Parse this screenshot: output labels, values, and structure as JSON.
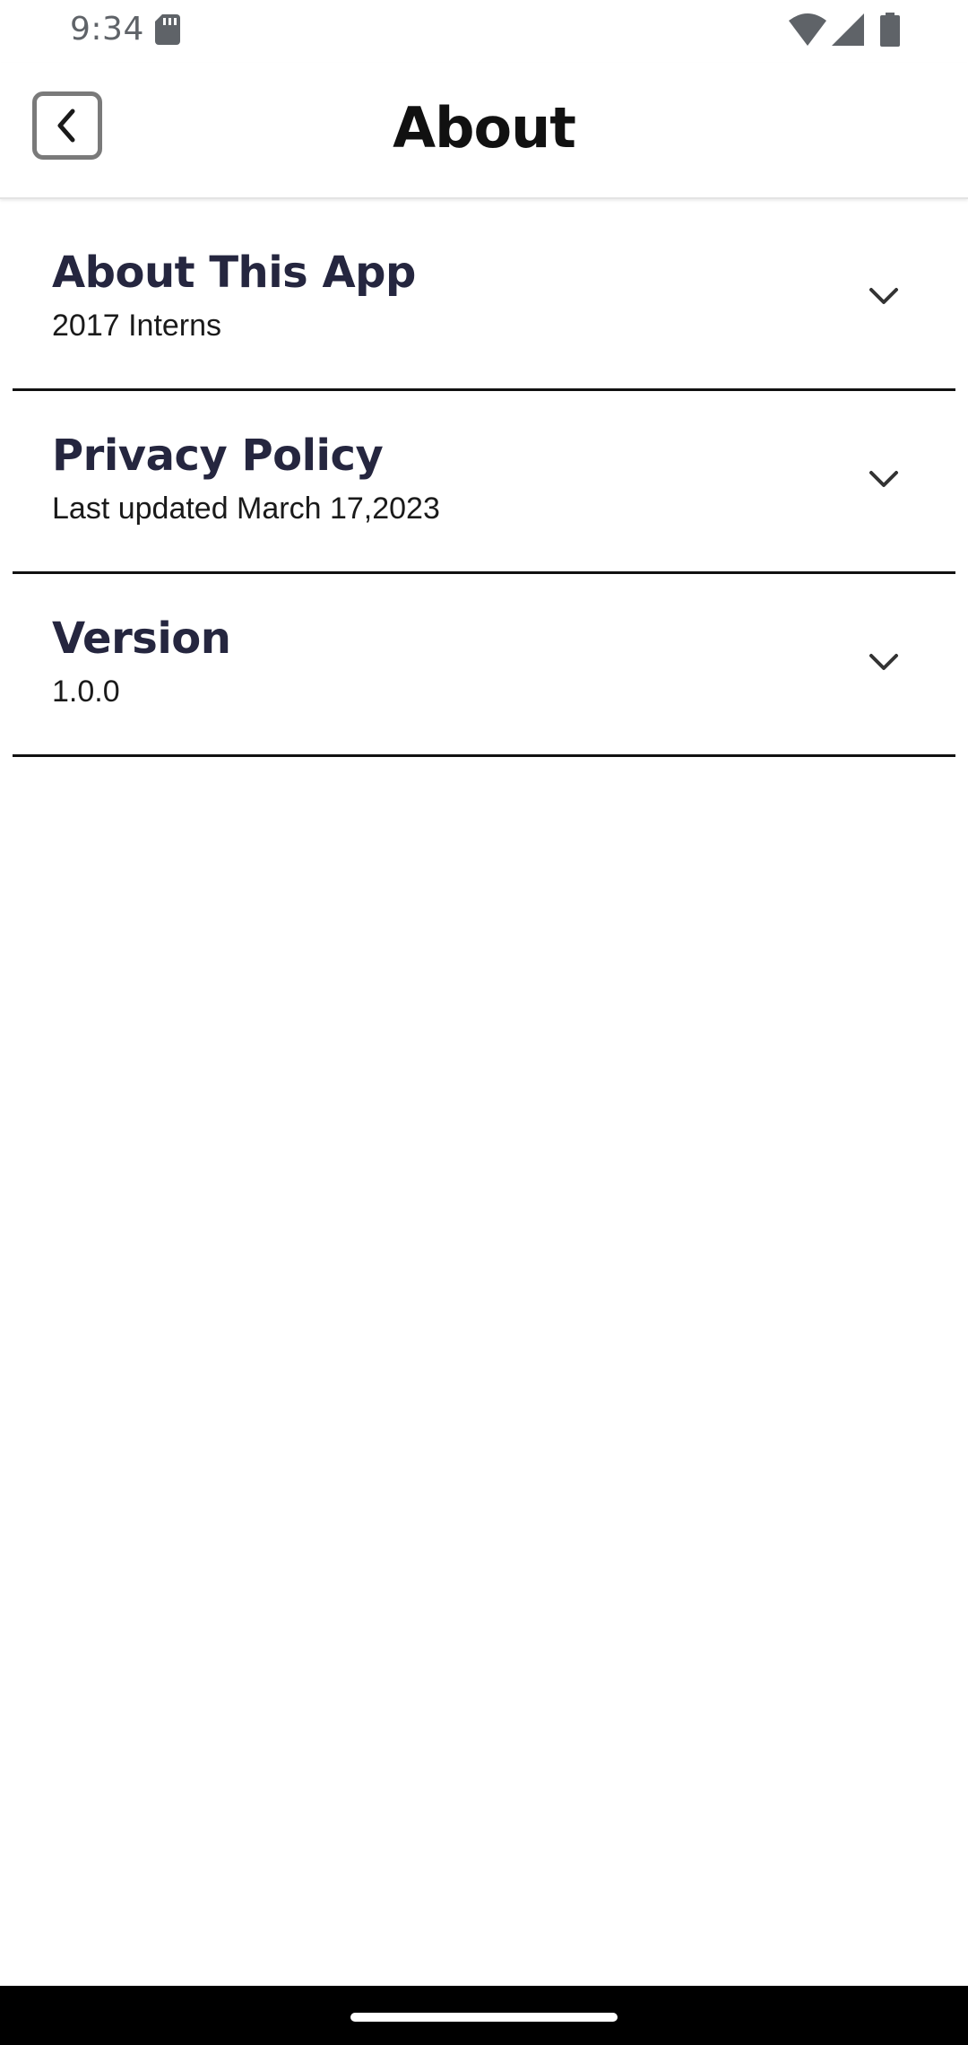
{
  "status_bar": {
    "time": "9:34",
    "icons": [
      "sd-card-icon",
      "wifi-icon",
      "signal-icon",
      "battery-icon"
    ]
  },
  "app_bar": {
    "title": "About",
    "back_icon": "chevron-left-icon"
  },
  "sections": [
    {
      "title": "About This App",
      "subtitle": "2017 Interns",
      "icon": "chevron-down-icon"
    },
    {
      "title": "Privacy Policy",
      "subtitle": "Last updated March 17,2023",
      "icon": "chevron-down-icon"
    },
    {
      "title": "Version",
      "subtitle": "1.0.0",
      "icon": "chevron-down-icon"
    }
  ],
  "colors": {
    "title_text": "#25263f",
    "divider": "#111111",
    "status_icons": "#5f6368",
    "nav_bar": "#000000"
  }
}
